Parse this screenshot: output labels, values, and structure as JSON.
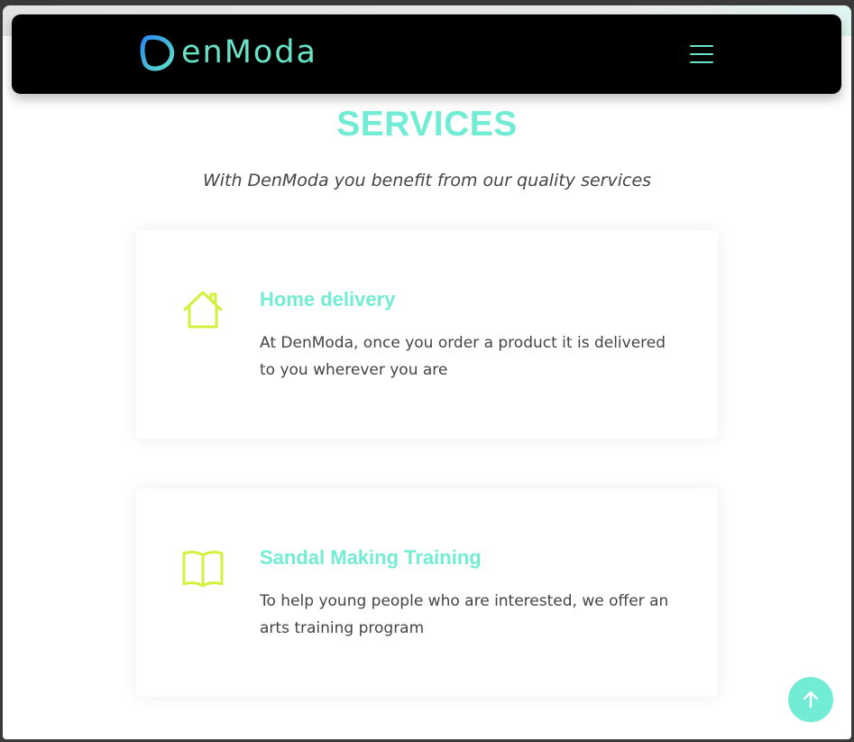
{
  "header": {
    "logo_text": "enModa",
    "logo_mark_icon": "D-ring-logo-icon",
    "menu_icon": "hamburger-menu-icon"
  },
  "services": {
    "title": "SERVICES",
    "subtitle": "With DenModa you benefit from our quality services",
    "items": [
      {
        "icon": "house-icon",
        "title": "Home delivery",
        "description": "At DenModa, once you order a product it is delivered to you wherever you are"
      },
      {
        "icon": "open-book-icon",
        "title": "Sandal Making Training",
        "description": "To help young people who are interested, we offer an arts training program"
      }
    ]
  },
  "scroll_top": {
    "icon": "arrow-up-icon"
  },
  "colors": {
    "accent": "#72ecd4",
    "icon_color": "#d4f03c",
    "navbar_bg": "#000000",
    "text": "#444444"
  }
}
